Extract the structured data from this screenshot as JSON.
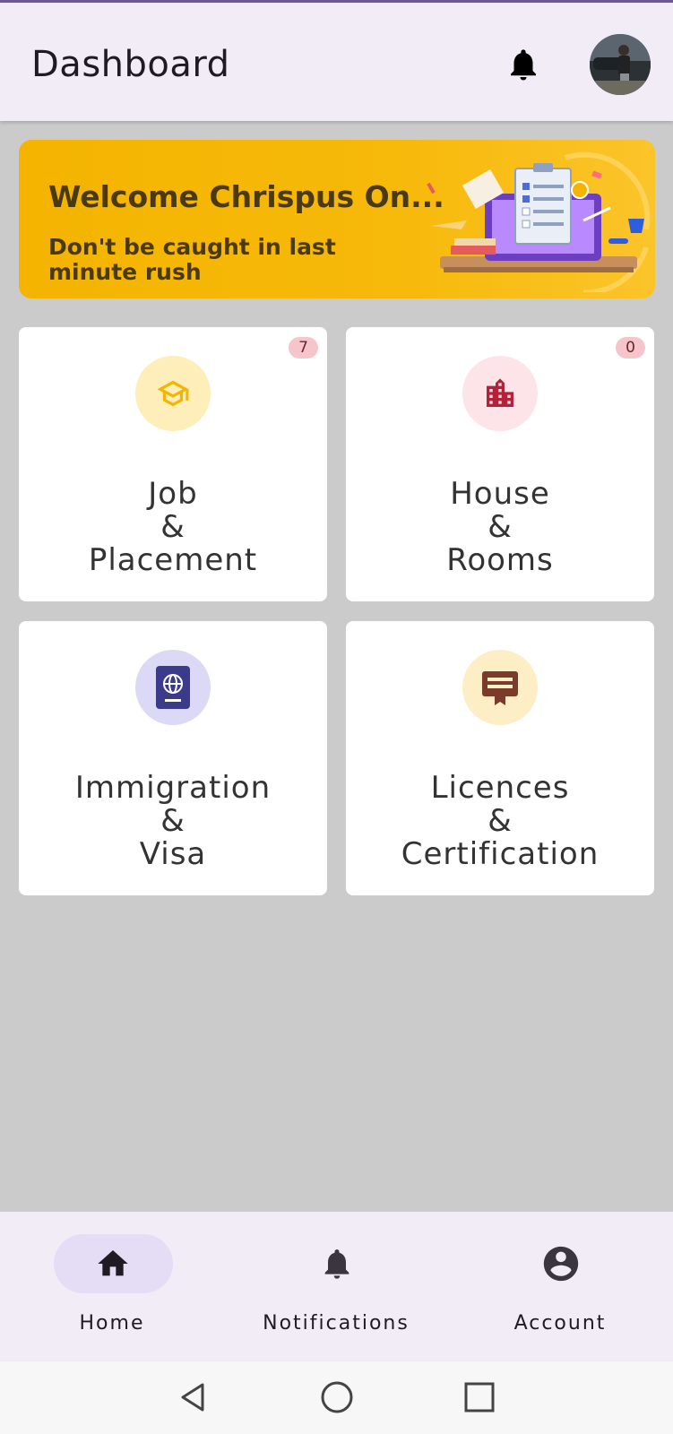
{
  "appbar": {
    "title": "Dashboard",
    "notification_icon": "bell-icon",
    "avatar_icon": "user-avatar"
  },
  "banner": {
    "welcome": "Welcome Chrispus On...",
    "subtitle": "Don't be caught in last minute rush",
    "illustration": "laptop-checklist-illustration"
  },
  "cards": [
    {
      "line1": "Job",
      "line2": "&",
      "line3": "Placement",
      "badge": "7",
      "icon": "graduation-cap-icon",
      "icon_bg": "#fdeeba",
      "icon_color": "#f4b400"
    },
    {
      "line1": "House",
      "line2": "&",
      "line3": "Rooms",
      "badge": "0",
      "icon": "building-icon",
      "icon_bg": "#fde4e8",
      "icon_color": "#b3223a"
    },
    {
      "line1": "Immigration",
      "line2": "&",
      "line3": "Visa",
      "icon": "passport-icon",
      "icon_bg": "#dcd9f7",
      "icon_color": "#3b3b8c"
    },
    {
      "line1": "Licences",
      "line2": "&",
      "line3": "Certification",
      "icon": "certificate-icon",
      "icon_bg": "#fdeec6",
      "icon_color": "#7a3b2a"
    }
  ],
  "bottom_nav": [
    {
      "label": "Home",
      "icon": "home-icon",
      "active": true
    },
    {
      "label": "Notifications",
      "icon": "bell-icon",
      "active": false
    },
    {
      "label": "Account",
      "icon": "account-circle-icon",
      "active": false
    }
  ],
  "system_nav": [
    "back-icon",
    "home-circle-icon",
    "recents-icon"
  ],
  "colors": {
    "appbar_bg": "#f2ecf6",
    "banner_bg": "#f4b400",
    "page_bg": "#cbcbcb",
    "badge_bg": "#f6c5cc",
    "active_pill": "#e5dcf6"
  }
}
